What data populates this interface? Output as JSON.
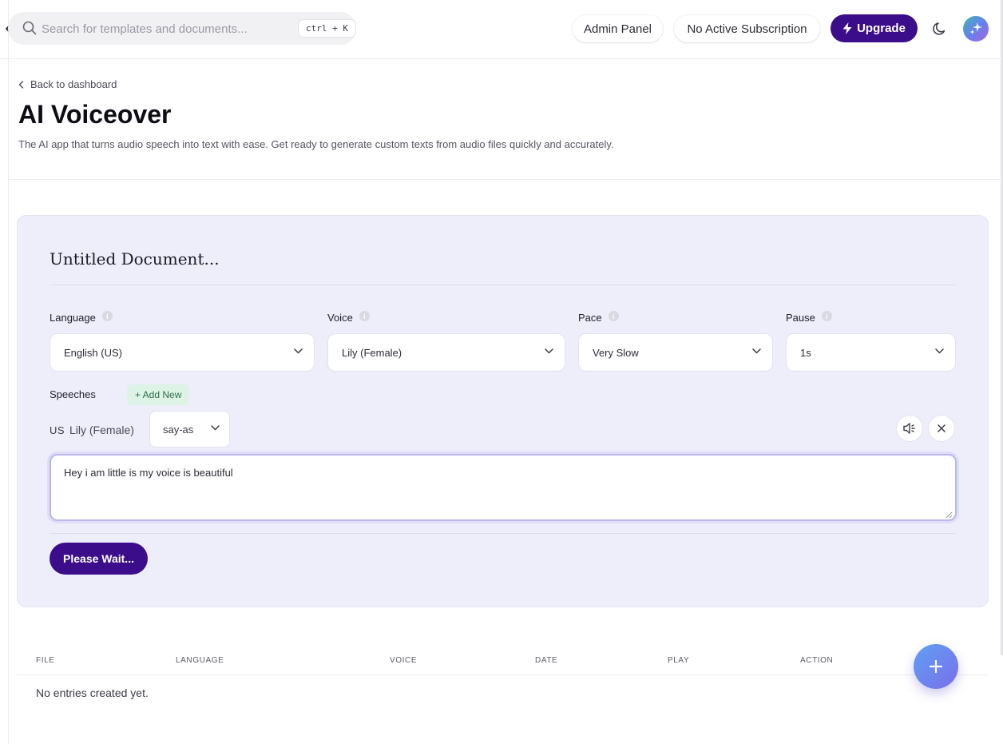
{
  "topbar": {
    "search_placeholder": "Search for templates and documents...",
    "shortcut": "ctrl + K",
    "admin_panel": "Admin Panel",
    "subscription": "No Active Subscription",
    "upgrade": "Upgrade",
    "icons": [
      "chevron-left-icon",
      "search-icon",
      "bolt-icon",
      "moon-icon",
      "sparkle-icon"
    ]
  },
  "header": {
    "back_label": "Back to dashboard",
    "title": "AI Voiceover",
    "subtitle": "The AI app that turns audio speech into text with ease. Get ready to generate custom texts from audio files quickly and accurately."
  },
  "form": {
    "document_title": "Untitled Document...",
    "fields": {
      "language": {
        "label": "Language",
        "value": "English (US)"
      },
      "voice": {
        "label": "Voice",
        "value": "Lily (Female)"
      },
      "pace": {
        "label": "Pace",
        "value": "Very Slow"
      },
      "pause": {
        "label": "Pause",
        "value": "1s"
      }
    },
    "speeches_label": "Speeches",
    "add_new": "+ Add New",
    "speech": {
      "lang_code": "US",
      "voice": "Lily (Female)",
      "say_as": "say-as",
      "text": "Hey i am little is my voice is beautiful"
    },
    "submit": "Please Wait..."
  },
  "table": {
    "columns": [
      "FILE",
      "LANGUAGE",
      "VOICE",
      "DATE",
      "PLAY",
      "ACTION"
    ],
    "empty_text": "No entries created yet."
  },
  "colors": {
    "brand": "#3b0d8a",
    "card_bg": "#eeeefb",
    "add_new_bg": "#dcf3e6",
    "fab_start": "#5fa0f5",
    "fab_end": "#7a6ee8"
  }
}
